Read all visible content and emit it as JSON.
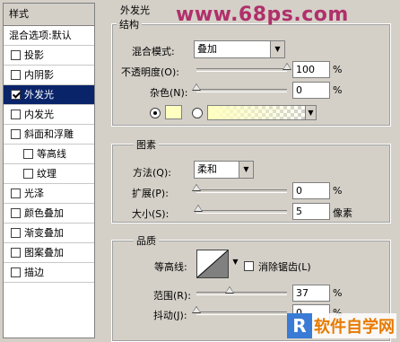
{
  "sidebar": {
    "header": "样式",
    "blend_options": "混合选项:默认",
    "items": [
      {
        "label": "投影",
        "checked": false
      },
      {
        "label": "内阴影",
        "checked": false
      },
      {
        "label": "外发光",
        "checked": true
      },
      {
        "label": "内发光",
        "checked": false
      },
      {
        "label": "斜面和浮雕",
        "checked": false
      },
      {
        "label": "等高线",
        "checked": false
      },
      {
        "label": "纹理",
        "checked": false
      },
      {
        "label": "光泽",
        "checked": false
      },
      {
        "label": "颜色叠加",
        "checked": false
      },
      {
        "label": "渐变叠加",
        "checked": false
      },
      {
        "label": "图案叠加",
        "checked": false
      },
      {
        "label": "描边",
        "checked": false
      }
    ]
  },
  "panel": {
    "title": "外发光",
    "structure": {
      "title": "结构",
      "blend_mode_label": "混合模式:",
      "blend_mode_value": "叠加",
      "opacity_label": "不透明度(O):",
      "opacity_value": "100",
      "opacity_unit": "%",
      "opacity_level": 1.0,
      "noise_label": "杂色(N):",
      "noise_value": "0",
      "noise_unit": "%",
      "noise_level": 0.0,
      "glow_color": "#ffffc0"
    },
    "elements": {
      "title": "图素",
      "technique_label": "方法(Q):",
      "technique_value": "柔和",
      "spread_label": "扩展(P):",
      "spread_value": "0",
      "spread_unit": "%",
      "spread_level": 0.0,
      "size_label": "大小(S):",
      "size_value": "5",
      "size_unit": "像素",
      "size_level": 0.02
    },
    "quality": {
      "title": "品质",
      "contour_label": "等高线:",
      "antialias_label": "消除锯齿(L)",
      "range_label": "范围(R):",
      "range_value": "37",
      "range_unit": "%",
      "range_level": 0.37,
      "jitter_label": "抖动(J):",
      "jitter_value": "0",
      "jitter_unit": "%",
      "jitter_level": 0.0
    }
  },
  "watermark": "www.68ps.com",
  "logo": {
    "mark": "R",
    "text": "软件自学网"
  }
}
